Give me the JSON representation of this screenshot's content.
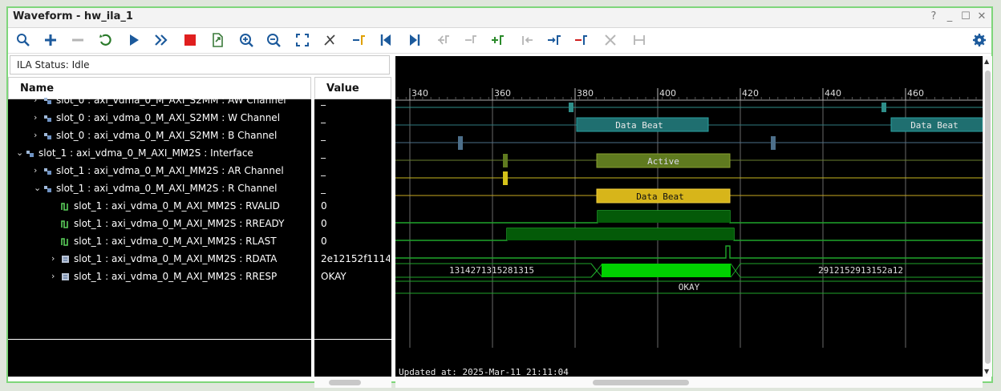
{
  "window": {
    "title": "Waveform - hw_ila_1",
    "help": "?",
    "min": "_",
    "max": "☐",
    "close": "✕"
  },
  "status": {
    "text": "ILA Status: Idle"
  },
  "columns": {
    "name": "Name",
    "value": "Value"
  },
  "rows": [
    {
      "label": "slot_0 : axi_vdma_0_M_AXI_S2MM : AW Channel",
      "value": "_",
      "expander": ">"
    },
    {
      "label": "slot_0 : axi_vdma_0_M_AXI_S2MM : W Channel",
      "value": "_",
      "expander": ">"
    },
    {
      "label": "slot_0 : axi_vdma_0_M_AXI_S2MM : B Channel",
      "value": "_",
      "expander": ">"
    },
    {
      "label": "slot_1 : axi_vdma_0_M_AXI_MM2S : Interface",
      "value": "_",
      "expander": "v"
    },
    {
      "label": "slot_1 : axi_vdma_0_M_AXI_MM2S : AR Channel",
      "value": "_",
      "expander": ">"
    },
    {
      "label": "slot_1 : axi_vdma_0_M_AXI_MM2S : R Channel",
      "value": "_",
      "expander": "v"
    },
    {
      "label": "slot_1 : axi_vdma_0_M_AXI_MM2S : RVALID",
      "value": "0",
      "expander": ""
    },
    {
      "label": "slot_1 : axi_vdma_0_M_AXI_MM2S : RREADY",
      "value": "0",
      "expander": ""
    },
    {
      "label": "slot_1 : axi_vdma_0_M_AXI_MM2S : RLAST",
      "value": "0",
      "expander": ""
    },
    {
      "label": "slot_1 : axi_vdma_0_M_AXI_MM2S : RDATA",
      "value": "2e12152f1114",
      "expander": ">"
    },
    {
      "label": "slot_1 : axi_vdma_0_M_AXI_MM2S : RRESP",
      "value": "OKAY",
      "expander": ">"
    }
  ],
  "timeline": {
    "ticks": [
      "340",
      "360",
      "380",
      "400",
      "420",
      "440",
      "460"
    ]
  },
  "waves": {
    "w_beat1": "Data Beat",
    "w_beat2": "Data Beat",
    "active": "Active",
    "r_beat": "Data Beat",
    "rdata_left": "1314271315281315",
    "rdata_right": "2912152913152a12",
    "rresp": "OKAY",
    "updated": "Updated at:  2025-Mar-11 21:11:04"
  },
  "colors": {
    "aw": "#2f8f8a",
    "w": "#1f6f70",
    "b": "#4d6f8a",
    "active": "#5f7a1f",
    "ar": "#d4c21a",
    "rbeat": "#d7b51a",
    "green": "#00d000",
    "trace": "#1fa52a"
  }
}
